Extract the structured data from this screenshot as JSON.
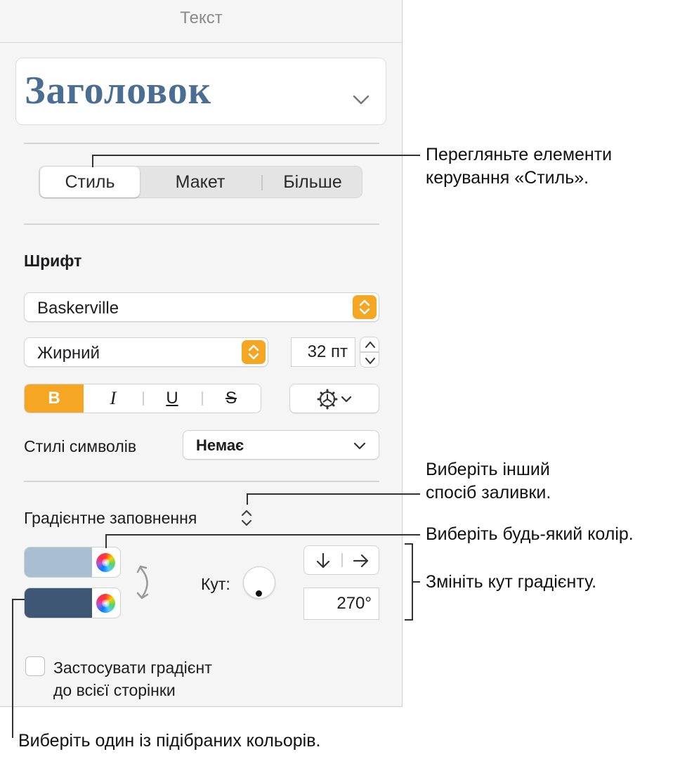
{
  "panel": {
    "title": "Текст",
    "style_name": "Заголовок"
  },
  "tabs": [
    {
      "label": "Стиль",
      "active": true
    },
    {
      "label": "Макет",
      "active": false
    },
    {
      "label": "Більше",
      "active": false
    }
  ],
  "font": {
    "section_label": "Шрифт",
    "family": "Baskerville",
    "typeface": "Жирний",
    "size": "32 пт",
    "format_buttons": {
      "bold": "B",
      "italic": "I",
      "underline": "U",
      "strikethrough": "S"
    }
  },
  "char_styles": {
    "label": "Стилі символів",
    "value": "Немає"
  },
  "fill": {
    "type_label": "Градієнтне заповнення",
    "color1": "#a9bdd3",
    "color2": "#3e5775",
    "angle_label": "Кут:",
    "angle_value": "270°",
    "apply_label_line1": "Застосувати градієнт",
    "apply_label_line2": "до всієї сторінки",
    "apply_checked": false
  },
  "colors": {
    "accent": "#f5a623",
    "style_text": "#4a6d94"
  },
  "callouts": {
    "style_controls_line1": "Перегляньте елементи",
    "style_controls_line2": "керування «Стиль».",
    "fill_type_line1": "Виберіть інший",
    "fill_type_line2": "спосіб заливки.",
    "any_color": "Виберіть будь-який колір.",
    "angle": "Змініть кут градієнту.",
    "preset_colors": "Виберіть один із підібраних кольорів."
  }
}
